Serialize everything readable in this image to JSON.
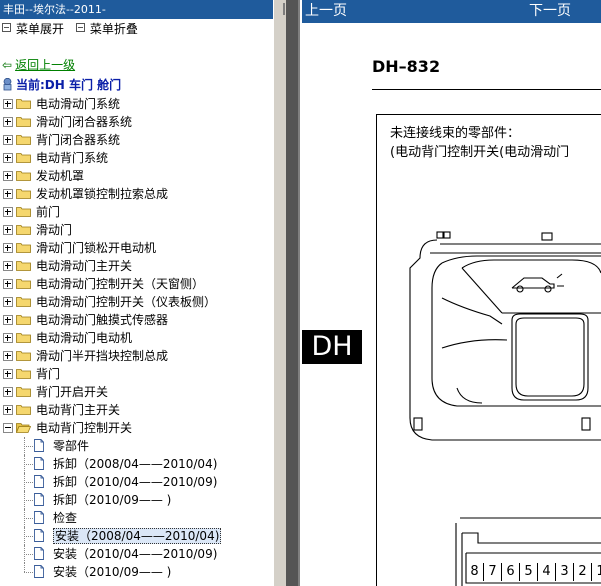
{
  "left_pane": {
    "title": "丰田--埃尔法--2011-",
    "menu": [
      "菜单展开",
      "菜单折叠"
    ],
    "back_link": "返回上一级",
    "current_label": "当前:DH 车门 舱门",
    "tree": [
      {
        "label": "电动滑动门系统",
        "type": "folder"
      },
      {
        "label": "滑动门闭合器系统",
        "type": "folder"
      },
      {
        "label": "背门闭合器系统",
        "type": "folder"
      },
      {
        "label": "电动背门系统",
        "type": "folder"
      },
      {
        "label": "发动机罩",
        "type": "folder"
      },
      {
        "label": "发动机罩锁控制拉索总成",
        "type": "folder"
      },
      {
        "label": "前门",
        "type": "folder"
      },
      {
        "label": "滑动门",
        "type": "folder"
      },
      {
        "label": "滑动门门锁松开电动机",
        "type": "folder"
      },
      {
        "label": "电动滑动门主开关",
        "type": "folder"
      },
      {
        "label": "电动滑动门控制开关（天窗侧）",
        "type": "folder"
      },
      {
        "label": "电动滑动门控制开关（仪表板侧）",
        "type": "folder"
      },
      {
        "label": "电动滑动门触摸式传感器",
        "type": "folder"
      },
      {
        "label": "电动滑动门电动机",
        "type": "folder"
      },
      {
        "label": "滑动门半开挡块控制总成",
        "type": "folder"
      },
      {
        "label": "背门",
        "type": "folder"
      },
      {
        "label": "背门开启开关",
        "type": "folder"
      },
      {
        "label": "电动背门主开关",
        "type": "folder"
      },
      {
        "label": "电动背门控制开关",
        "type": "folder-open",
        "children": [
          {
            "label": "零部件"
          },
          {
            "label": "拆卸（2008/04——2010/04)"
          },
          {
            "label": "拆卸（2010/04——2010/09)"
          },
          {
            "label": "拆卸（2010/09—— )"
          },
          {
            "label": "检查"
          },
          {
            "label": "安装（2008/04——2010/04)",
            "selected": true
          },
          {
            "label": "安装（2010/04——2010/09)"
          },
          {
            "label": "安装（2010/09—— )"
          }
        ]
      }
    ]
  },
  "right_pane": {
    "nav": {
      "prev": "上一页",
      "next": "下一页"
    },
    "page_number": "DH–832",
    "section_tab": "DH",
    "note_line1": "未连接线束的零部件：",
    "note_line2": "(电动背门控制开关(电动滑动门",
    "connector_pins": [
      "8",
      "7",
      "6",
      "5",
      "4",
      "3",
      "2",
      "1"
    ]
  }
}
